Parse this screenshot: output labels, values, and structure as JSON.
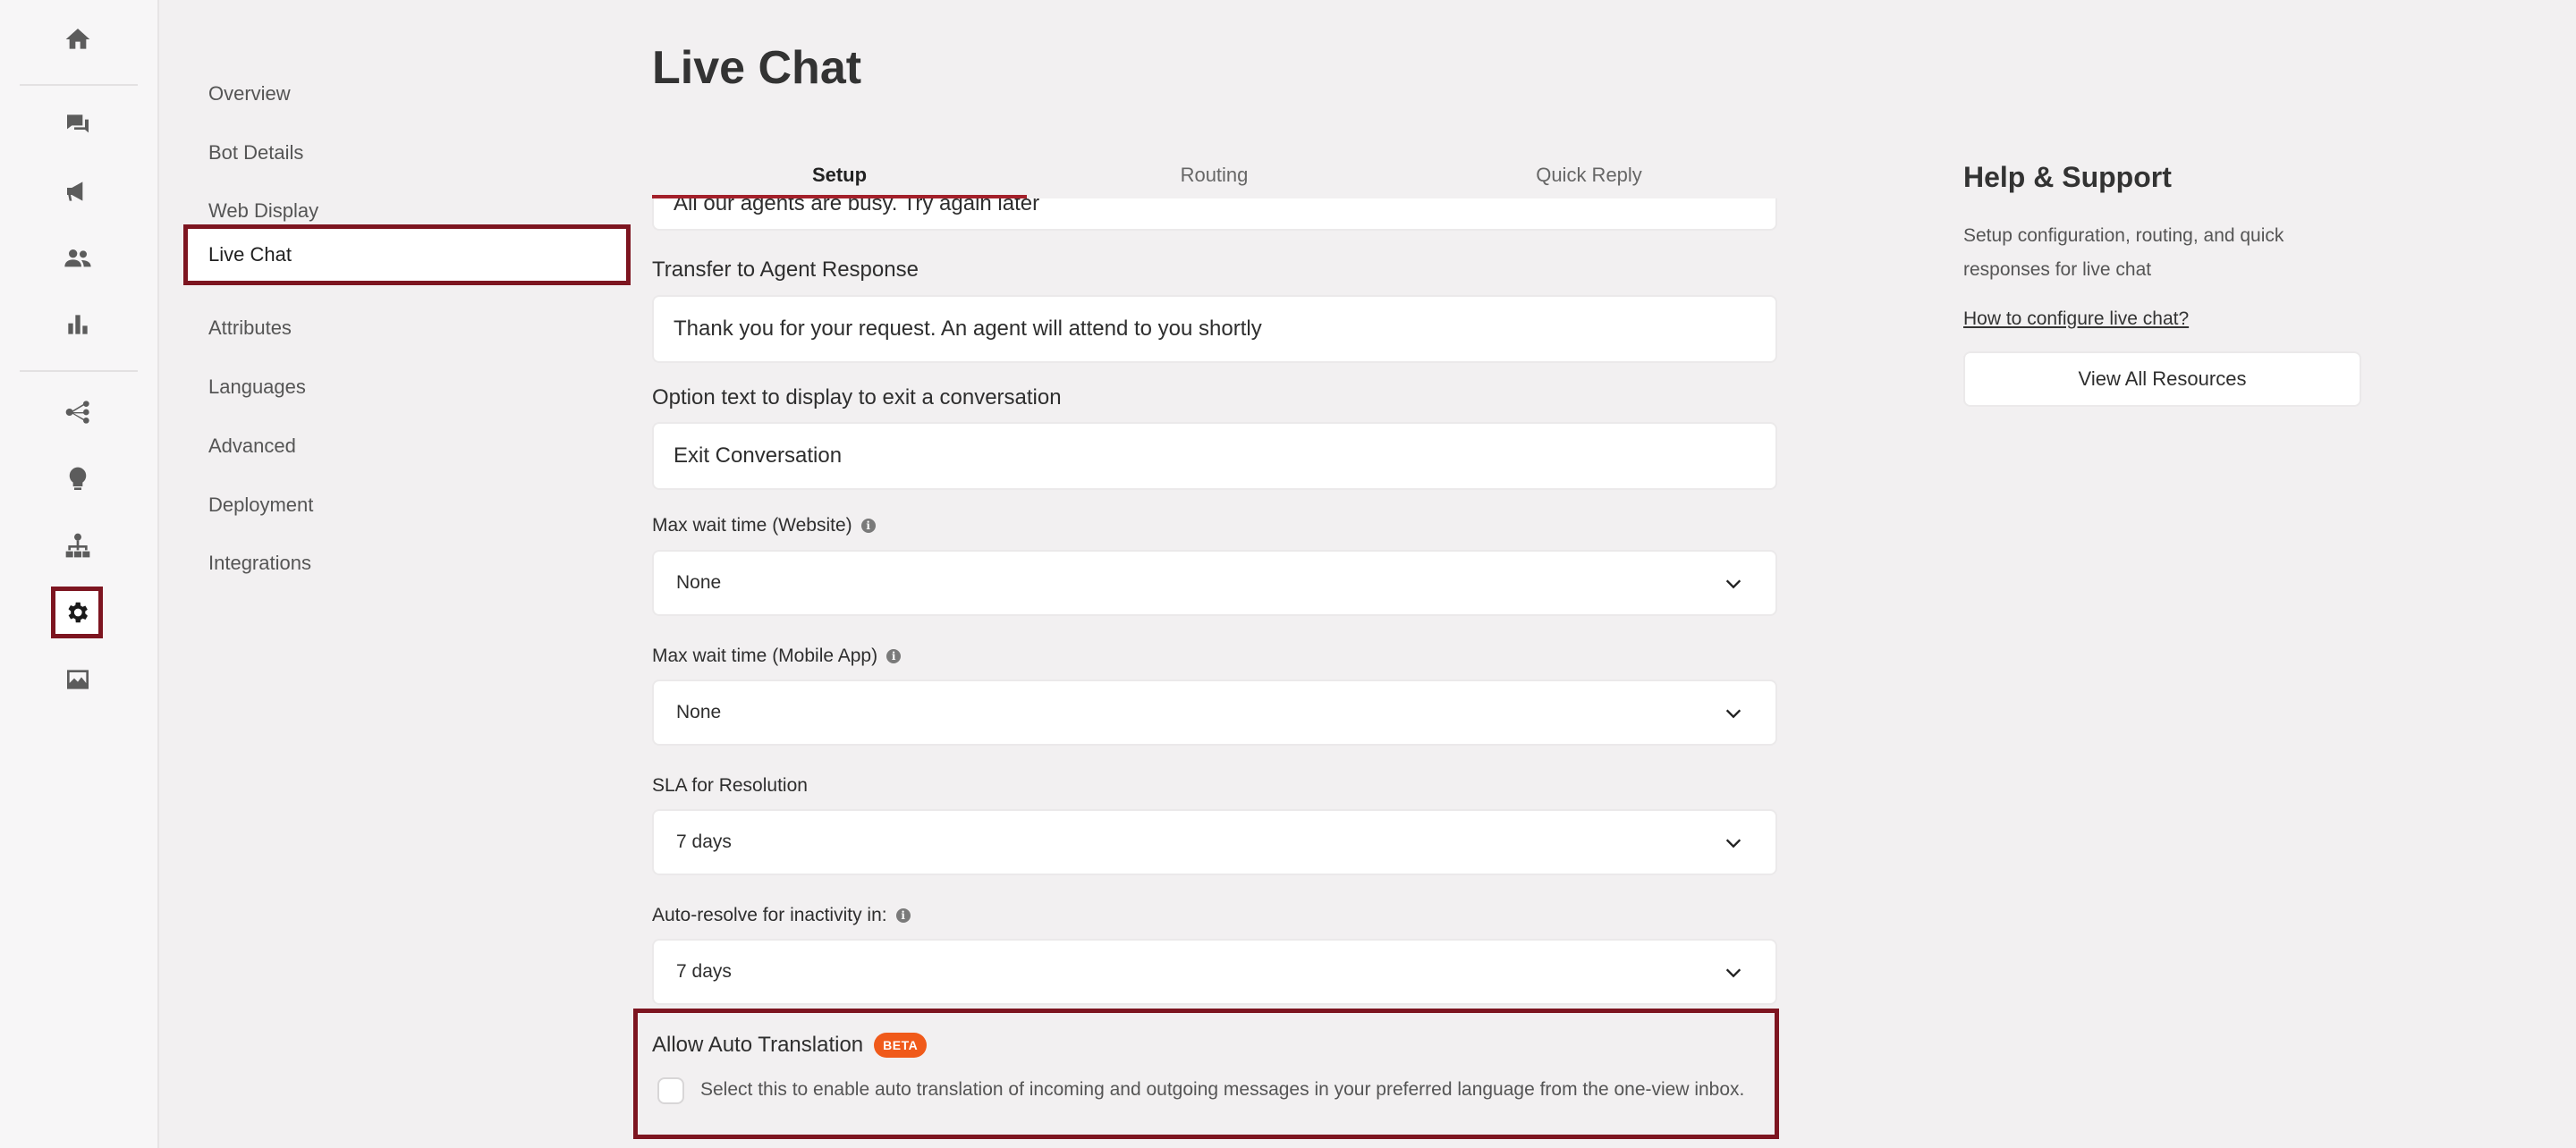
{
  "rail": {
    "icons": [
      "home-icon",
      "chat-icon",
      "megaphone-icon",
      "users-icon",
      "bar-chart-icon",
      "flow-icon",
      "lightbulb-icon",
      "hierarchy-icon",
      "gear-icon",
      "image-icon"
    ],
    "active": "gear-icon"
  },
  "subnav": {
    "items": [
      {
        "label": "Overview"
      },
      {
        "label": "Bot Details"
      },
      {
        "label": "Web Display"
      },
      {
        "label": "Live Chat"
      },
      {
        "label": "Attributes"
      },
      {
        "label": "Languages"
      },
      {
        "label": "Advanced"
      },
      {
        "label": "Deployment"
      },
      {
        "label": "Integrations"
      }
    ],
    "active_label": "Live Chat"
  },
  "page": {
    "title": "Live Chat"
  },
  "tabs": [
    {
      "label": "Setup"
    },
    {
      "label": "Routing"
    },
    {
      "label": "Quick Reply"
    }
  ],
  "form": {
    "partial_value": "All our agents are busy. Try again later",
    "transfer": {
      "label": "Transfer to Agent Response",
      "value": "Thank you for your request. An agent will attend to you shortly"
    },
    "exit_option": {
      "label": "Option text to display to exit a conversation",
      "value": "Exit Conversation"
    },
    "max_wait_web": {
      "label": "Max wait time (Website)",
      "value": "None"
    },
    "max_wait_app": {
      "label": "Max wait time (Mobile App)",
      "value": "None"
    },
    "sla": {
      "label": "SLA for Resolution",
      "value": "7 days"
    },
    "auto_resolve": {
      "label": "Auto-resolve for inactivity in:",
      "value": "7 days"
    },
    "auto_translation": {
      "label": "Allow Auto Translation",
      "badge": "BETA",
      "description": "Select this to enable auto translation of incoming and outgoing messages in your preferred language from the one-view inbox.",
      "checked": false
    }
  },
  "help": {
    "title": "Help & Support",
    "description": "Setup configuration, routing, and quick responses for live chat",
    "link": "How to configure live chat?",
    "button": "View All Resources"
  },
  "colors": {
    "accent": "#a3202a",
    "highlight_border": "#7d1520",
    "beta": "#f05a1a"
  }
}
